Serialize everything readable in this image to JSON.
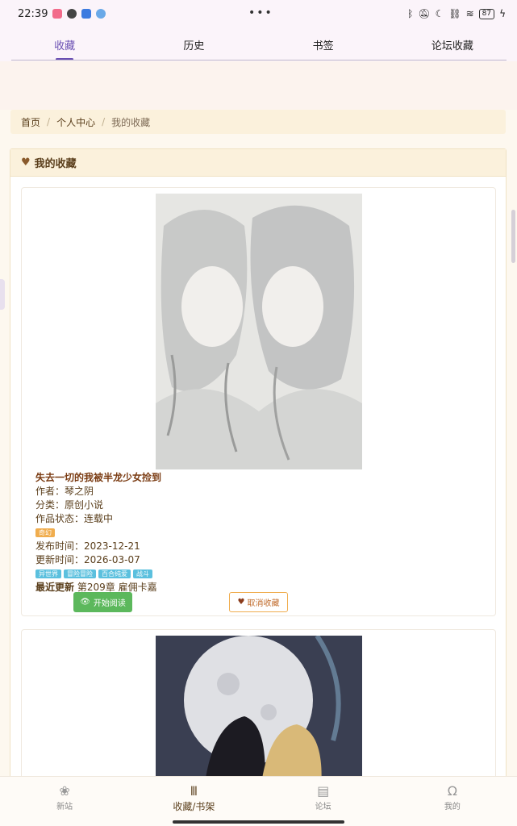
{
  "status_bar": {
    "time": "22:39",
    "battery": "87"
  },
  "tabs": [
    {
      "label": "收藏",
      "active": true
    },
    {
      "label": "历史",
      "active": false
    },
    {
      "label": "书签",
      "active": false
    },
    {
      "label": "论坛收藏",
      "active": false
    }
  ],
  "breadcrumb": {
    "home": "首页",
    "center": "个人中心",
    "current": "我的收藏"
  },
  "panel": {
    "title": "我的收藏"
  },
  "books": [
    {
      "title": "失去一切的我被半龙少女捡到",
      "author_label": "作者：",
      "author": "琴之阴",
      "category_label": "分类：",
      "category": "原创小说",
      "status_label": "作品状态：",
      "status": "连载中",
      "genre": "奇幻",
      "published_label": "发布时间：",
      "published": "2023-12-21",
      "updated_label": "更新时间：",
      "updated": "2026-03-07",
      "tags": [
        "异世界",
        "冒险冒险",
        "百合纯爱",
        "战斗"
      ],
      "latest_label": "最近更新",
      "latest": "第209章 雇佣卡嘉",
      "read_button": "开始阅读",
      "unfav_button": "取消收藏"
    }
  ],
  "bottom_nav": [
    {
      "label": "新站",
      "icon": "flower-icon",
      "active": false
    },
    {
      "label": "收藏/书架",
      "icon": "bookshelf-icon",
      "active": true
    },
    {
      "label": "论坛",
      "icon": "chat-icon",
      "active": false
    },
    {
      "label": "我的",
      "icon": "user-icon",
      "active": false
    }
  ],
  "colors": {
    "accent": "#6a4fb3",
    "brown": "#5a3e1b",
    "green": "#5cb85c",
    "orange": "#f0ad4e",
    "blue": "#5bc0de"
  }
}
